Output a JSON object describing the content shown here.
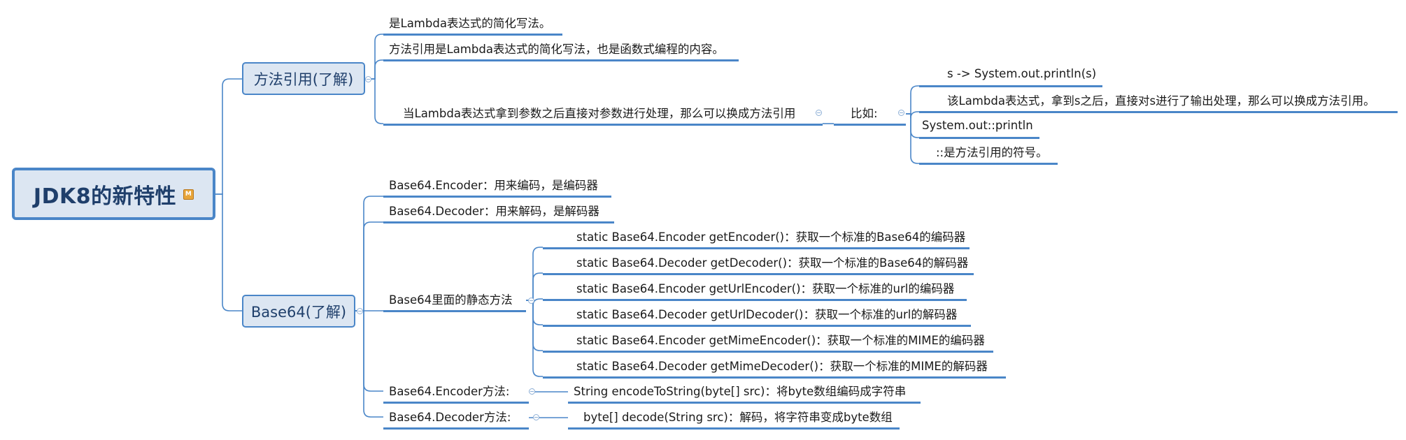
{
  "root": {
    "title": "JDK8的新特性",
    "marker": "M"
  },
  "method_ref": {
    "title": "方法引用(了解)",
    "item1": "是Lambda表达式的简化写法。",
    "item2": "方法引用是Lambda表达式的简化写法，也是函数式编程的内容。",
    "item3": "当Lambda表达式拿到参数之后直接对参数进行处理，那么可以换成方法引用",
    "example_label": "比如:",
    "examples": [
      "s -> System.out.println(s)",
      "该Lambda表达式，拿到s之后，直接对s进行了输出处理，那么可以换成方法引用。",
      "System.out::println",
      "::是方法引用的符号。"
    ]
  },
  "base64": {
    "title": "Base64(了解)",
    "encoder": "Base64.Encoder：用来编码，是编码器",
    "decoder": "Base64.Decoder：用来解码，是解码器",
    "static_label": "Base64里面的静态方法",
    "static_methods": [
      "static Base64.Encoder getEncoder()：获取一个标准的Base64的编码器",
      "static Base64.Decoder getDecoder()：获取一个标准的Base64的解码器",
      "static Base64.Encoder getUrlEncoder()：获取一个标准的url的编码器",
      "static Base64.Decoder getUrlDecoder()：获取一个标准的url的解码器",
      "static Base64.Encoder getMimeEncoder()：获取一个标准的MIME的编码器",
      "static Base64.Decoder getMimeDecoder()：获取一个标准的MIME的解码器"
    ],
    "encoder_method_label": "Base64.Encoder方法:",
    "encoder_method": "String encodeToString(byte[] src)：将byte数组编码成字符串",
    "decoder_method_label": "Base64.Decoder方法:",
    "decoder_method": "byte[] decode(String src)：解码，将字符串变成byte数组"
  },
  "colors": {
    "line": "#4a86c8",
    "topic_fill": "#dce6f2",
    "root_text": "#1f3f6b"
  }
}
